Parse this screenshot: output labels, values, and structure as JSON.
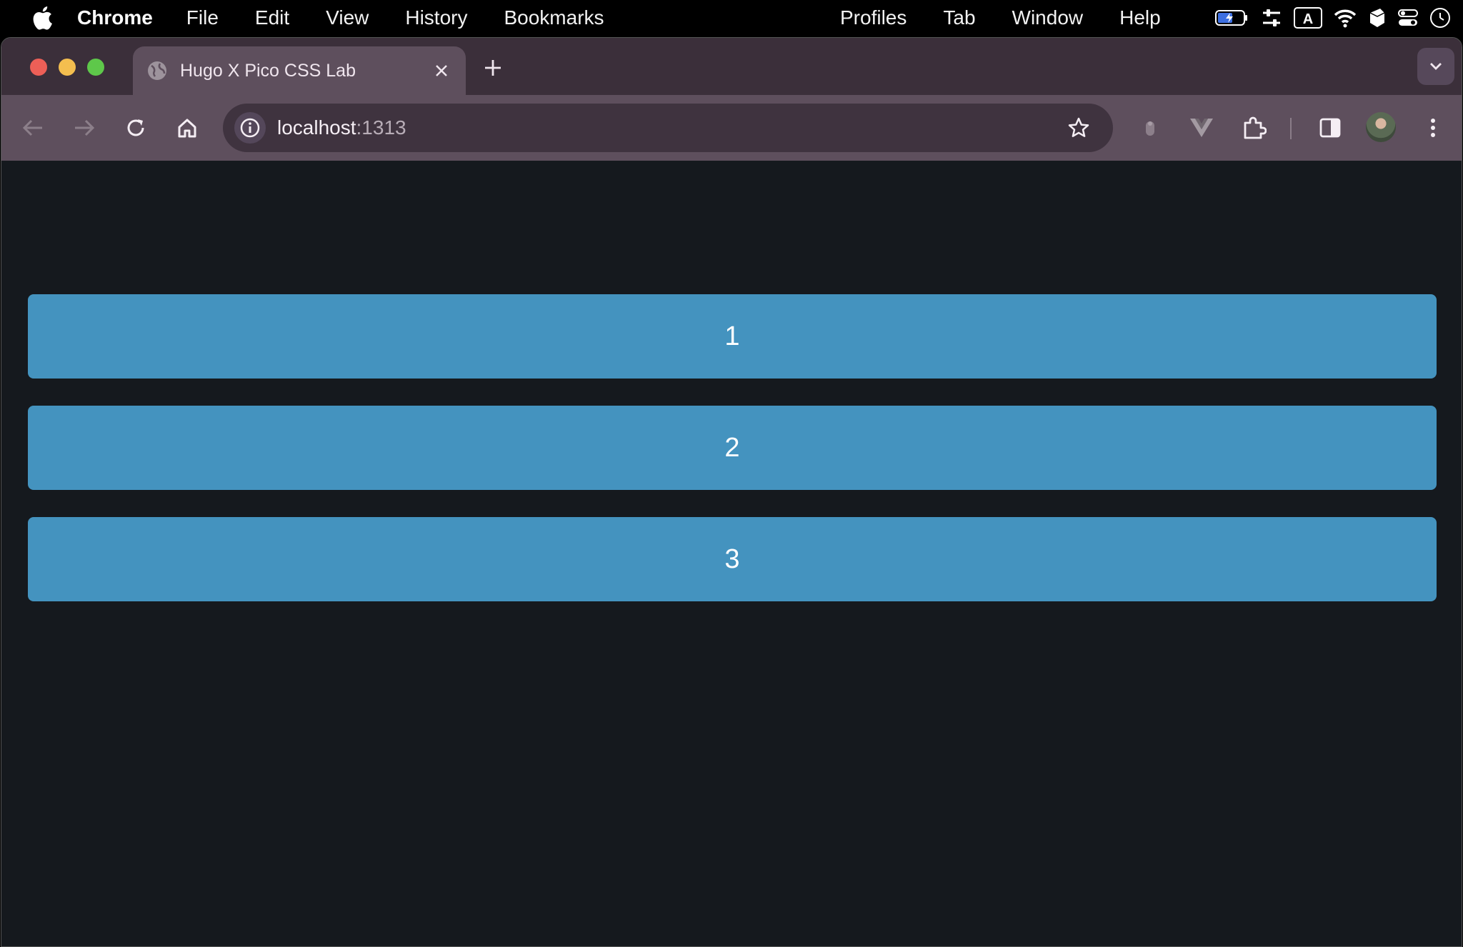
{
  "menubar": {
    "app_name": "Chrome",
    "items": [
      "File",
      "Edit",
      "View",
      "History",
      "Bookmarks"
    ],
    "right_items": [
      "Profiles",
      "Tab",
      "Window",
      "Help"
    ],
    "status_icons": [
      "battery-icon",
      "control-sliders-icon",
      "input-source-icon",
      "wifi-icon",
      "app-icon",
      "control-center-icon",
      "clock-icon"
    ],
    "input_source_letter": "A"
  },
  "browser": {
    "tab": {
      "title": "Hugo X Pico CSS Lab",
      "favicon": "globe-icon"
    },
    "address": {
      "host": "localhost",
      "port": ":1313"
    },
    "toolbar_icons": [
      "back-icon",
      "forward-icon",
      "reload-icon",
      "home-icon",
      "info-icon",
      "star-icon",
      "extension-mouse-icon",
      "vue-devtools-icon",
      "extensions-icon",
      "side-panel-icon",
      "avatar",
      "menu-icon"
    ]
  },
  "page": {
    "items": [
      {
        "label": "1"
      },
      {
        "label": "2"
      },
      {
        "label": "3"
      }
    ]
  },
  "colors": {
    "menubar_bg": "#000000",
    "tabstrip_bg": "#3b2f3a",
    "toolbar_bg": "#5e4f5d",
    "page_bg": "#15191e",
    "item_bg": "#4493bf"
  }
}
